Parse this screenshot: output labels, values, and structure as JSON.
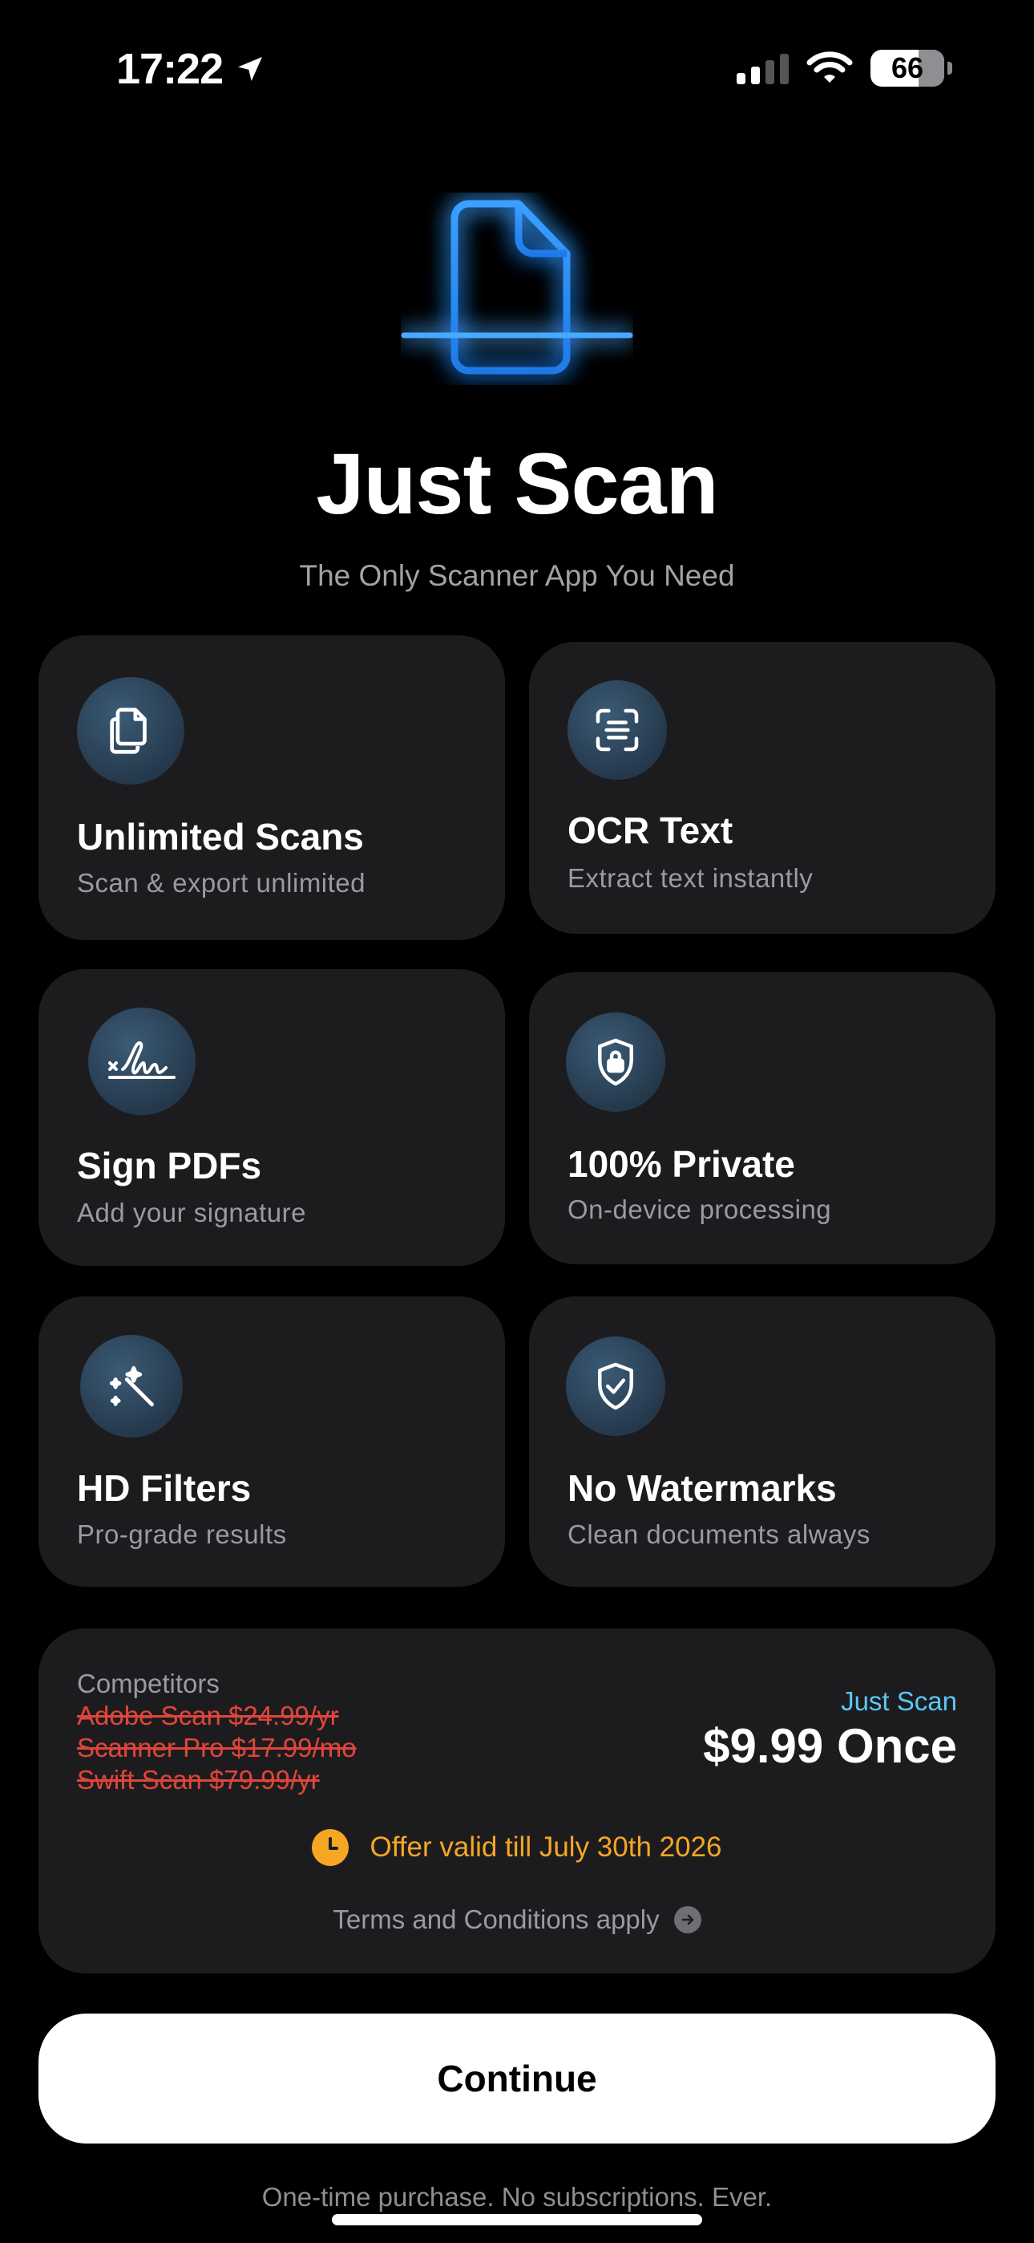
{
  "status_bar": {
    "time": "17:22",
    "battery": "66"
  },
  "hero": {
    "title": "Just Scan",
    "subtitle": "The Only Scanner App You Need",
    "icon": "document-scan-icon",
    "accent": "#2f8cf0"
  },
  "features": [
    {
      "title": "Unlimited Scans",
      "desc": "Scan & export unlimited",
      "icon": "documents-icon"
    },
    {
      "title": "OCR Text",
      "desc": "Extract text instantly",
      "icon": "text-scan-icon"
    },
    {
      "title": "Sign PDFs",
      "desc": "Add your signature",
      "icon": "signature-icon"
    },
    {
      "title": "100% Private",
      "desc": "On-device processing",
      "icon": "lock-shield-icon"
    },
    {
      "title": "HD Filters",
      "desc": "Pro-grade results",
      "icon": "magic-wand-icon"
    },
    {
      "title": "No Watermarks",
      "desc": "Clean documents always",
      "icon": "checkmark-shield-icon"
    }
  ],
  "pricing": {
    "competitors_label": "Competitors",
    "competitors": [
      "Adobe Scan $24.99/yr",
      "Scanner Pro $17.99/mo",
      "Swift Scan $79.99/yr"
    ],
    "app_label": "Just Scan",
    "price": "$9.99 Once",
    "offer": "Offer valid till July 30th 2026",
    "terms": "Terms and Conditions apply",
    "competitor_color": "#e0453a",
    "offer_color": "#f5a623",
    "app_label_color": "#5ac8fa"
  },
  "cta": {
    "label": "Continue"
  },
  "footer": {
    "note": "One-time purchase. No subscriptions. Ever."
  }
}
